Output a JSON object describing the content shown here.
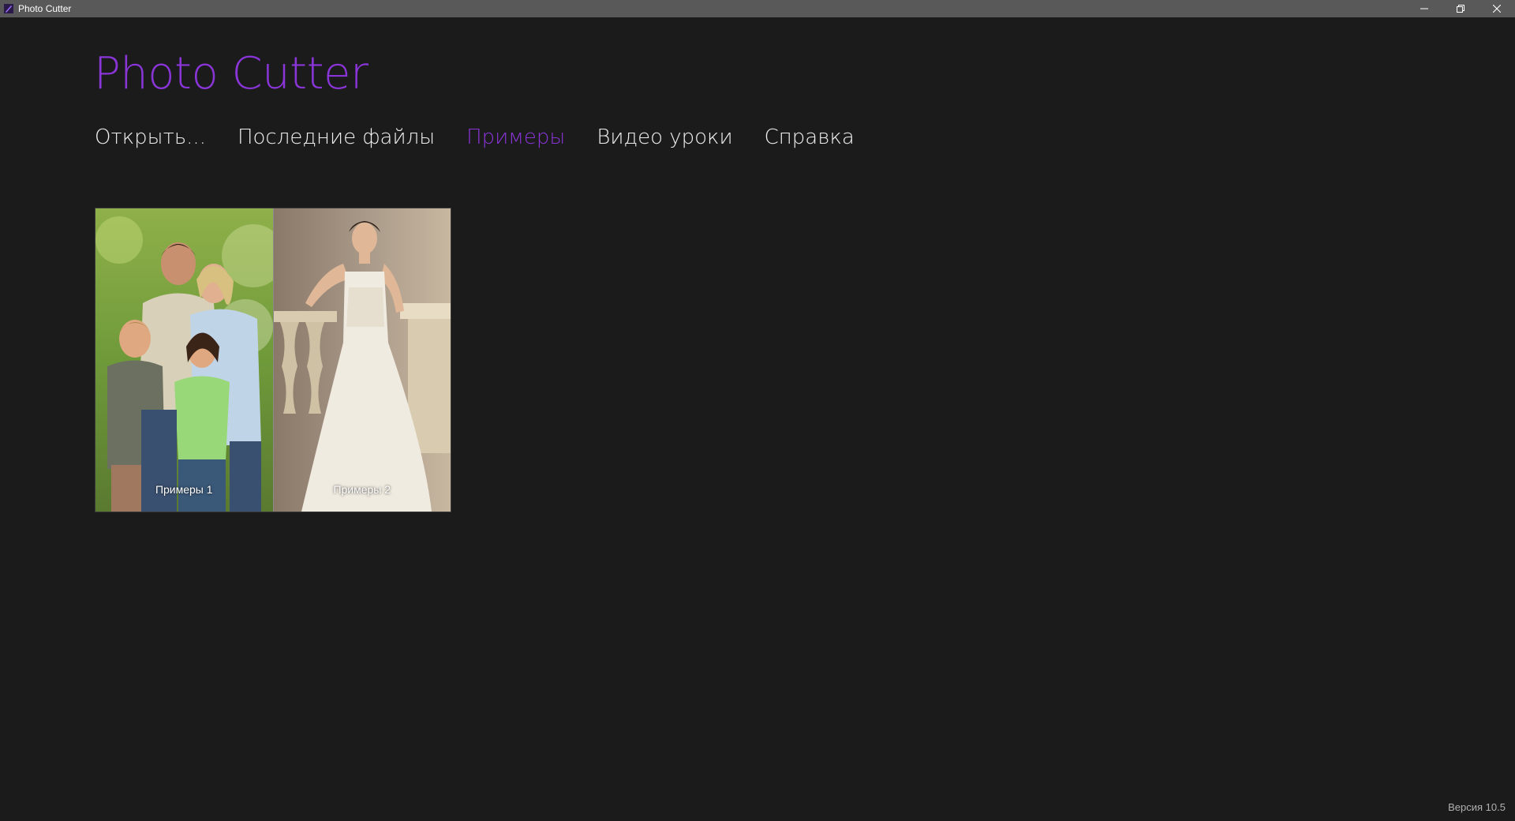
{
  "window": {
    "title": "Photo Cutter",
    "icon": "photo-cutter-app-icon",
    "controls": [
      "minimize-icon",
      "restore-icon",
      "close-icon"
    ]
  },
  "header": {
    "app_title": "Photo Cutter"
  },
  "nav": {
    "items": [
      {
        "label": "Открыть..."
      },
      {
        "label": "Последние файлы"
      },
      {
        "label": "Примеры"
      },
      {
        "label": "Видео уроки"
      },
      {
        "label": "Справка"
      }
    ],
    "active": "Примеры"
  },
  "examples": {
    "tiles": [
      {
        "label": "Примеры 1"
      },
      {
        "label": "Примеры 2"
      }
    ]
  },
  "footer": {
    "version": "Версия 10.5"
  },
  "colors": {
    "accent": "#8a35d8",
    "background": "#1b1b1b",
    "titlebar": "#595959"
  }
}
